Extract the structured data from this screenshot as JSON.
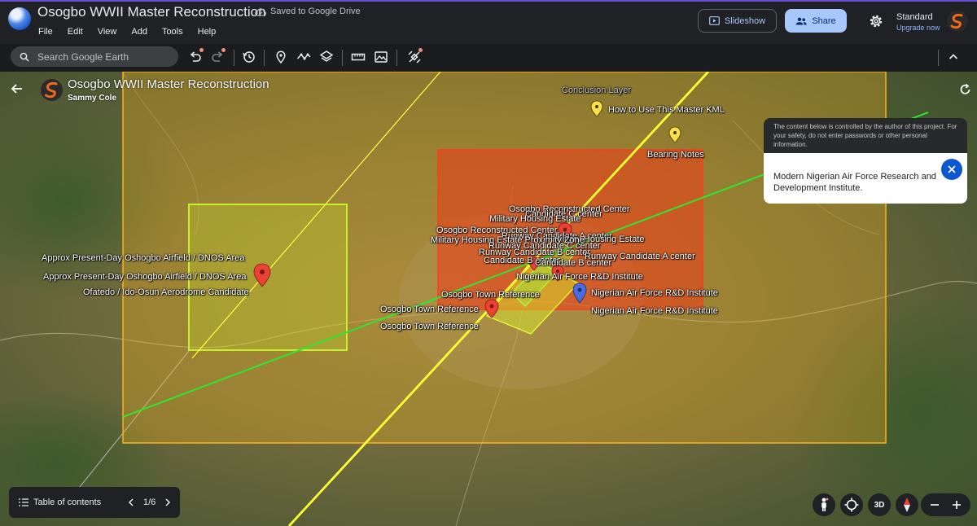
{
  "app": {
    "doc_title": "Osogbo WWII Master Reconstruction",
    "saved_status": "Saved to Google Drive",
    "menu": [
      "File",
      "Edit",
      "View",
      "Add",
      "Tools",
      "Help"
    ],
    "slideshow_label": "Slideshow",
    "share_label": "Share",
    "plan_label": "Standard",
    "upgrade_label": "Upgrade now"
  },
  "toolbar": {
    "search_placeholder": "Search Google Earth",
    "icons": [
      "undo-icon",
      "redo-icon",
      "history-icon",
      "placemark-icon",
      "path-icon",
      "layers-icon",
      "measure-icon",
      "image-overlay-icon",
      "satellite-tools-icon",
      "collapse-icon"
    ]
  },
  "project": {
    "title": "Osogbo WWII Master Reconstruction",
    "author": "Sammy Cole"
  },
  "map_labels": {
    "conclusion_layer": "Conclusion Layer",
    "how_to_use": "How to Use This Master KML",
    "bearing_notes": "Bearing Notes",
    "reconstructed_center_1": "Osogbo Reconstructed Center",
    "candidate_c_center_1": "Candidate C center",
    "military_housing_estate_1": "Military Housing Estate",
    "reconstructed_center_2": "Osogbo Reconstructed Center",
    "runway_candidate_a_center_1": "Runway Candidate A center",
    "military_housing_estate_2": "Military Housing Estate",
    "military_housing_proximity": "Military Housing Estate Proximity Zone",
    "runway_candidate_c_center": "Runway Candidate C center",
    "runway_candidate_b_center": "Runway Candidate B center",
    "runway_candidate_a_center_2": "Runway Candidate A center",
    "candidate_b_center": "Candidate B center",
    "nigerian_af_rd_1": "Nigerian Air Force R&D Institute",
    "nigerian_af_rd_2": "Nigerian Air Force R&D Institute",
    "nigerian_af_rd_3": "Nigerian Air Force R&D Institute",
    "osogbo_town_ref_1": "Osogbo Town Reference",
    "osogbo_town_ref_2": "Osogbo Town Reference",
    "osogbo_town_ref_3": "Osogbo Town Reference",
    "airfield_1": "Approx Present-Day Oshogbo Airfield / DNOS Area",
    "airfield_2": "Approx Present-Day Oshogbo Airfield / DNOS Area",
    "ofatedo": "Ofatedo / Ido-Osun Aerodrome Candidate"
  },
  "info_card": {
    "warning": "The content below is controlled by the author of this project. For your safety, do not enter passwords or other personal information.",
    "body": "Modern Nigerian Air Force Research and Development Institute."
  },
  "bottom": {
    "toc_label": "Table of contents",
    "page_indicator": "1/6",
    "view_3d_label": "3D"
  },
  "colors": {
    "accent": "#6a4fd6",
    "share_bg": "#a8c7fa",
    "outer_zone": "#f2b01e",
    "red_zone": "#f03a17",
    "green_zone": "#c6f02a",
    "yellow_line": "#ffff33",
    "green_line": "#2ee62e",
    "pin_red": "#ea4335",
    "pin_yellow": "#fde047",
    "pin_blue": "#4a6ee0"
  }
}
